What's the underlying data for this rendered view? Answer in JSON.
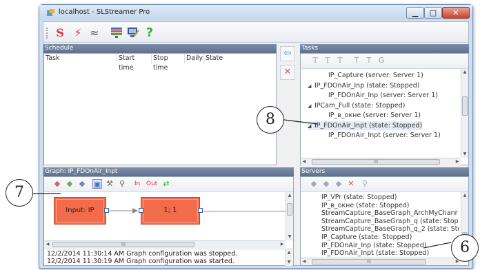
{
  "window": {
    "title": "localhost - SLStreamer Pro",
    "min_glyph": "▁",
    "max_glyph": "□",
    "close_glyph": "✕"
  },
  "toolbar": {
    "icons": [
      "s-logo-icon",
      "lightning-icon",
      "waves-icon",
      "monitor-tasks-icon",
      "monitor-edit-icon",
      "help-icon"
    ]
  },
  "schedule": {
    "header": "Schedule",
    "columns": [
      "Task",
      "Start time",
      "Stop time",
      "Daily",
      "State"
    ]
  },
  "tasks": {
    "header": "Tasks",
    "items": [
      {
        "indent": 2,
        "arrow": "",
        "text": "IP_Capture (server: Server 1)"
      },
      {
        "indent": 1,
        "arrow": "◢",
        "text": "IP_FDOnAir_Inp (state: Stopped)"
      },
      {
        "indent": 2,
        "arrow": "",
        "text": "IP_FDOnAir_Inp (server: Server 1)"
      },
      {
        "indent": 1,
        "arrow": "◢",
        "text": "IPCam_Full (state: Stopped)"
      },
      {
        "indent": 2,
        "arrow": "",
        "text": "IP_в_окне (server: Server 1)"
      },
      {
        "indent": 1,
        "arrow": "◢",
        "text": "IP_FDOnAir_Inpt (state: Stopped)"
      },
      {
        "indent": 2,
        "arrow": "",
        "text": "IP_FDOnAir_Inpt (server: Server 1)"
      }
    ],
    "hscroll_grip": "III"
  },
  "graph": {
    "header": "Graph: IP_FDOnAir_Inpt",
    "node_input": "Input: IP",
    "node_second": "1; 1",
    "hscroll_grip": "III",
    "log": [
      "12/2/2014 11:30:14 AM Graph configuration was stopped.",
      "12/2/2014 11:30:19 AM Graph configuration was started."
    ]
  },
  "servers": {
    "header": "Servers",
    "items": [
      "IP_VPr (state: Stopped)",
      "IP_в_окне (state: Stopped)",
      "StreamCapture_BaseGraph_ArchMyChanr",
      "StreamCapture_BaseGraph_q (state: Stop",
      "StreamCapture_BaseGraph_q_2 (state: Sto",
      "IP_Capture (state: Stopped)",
      "IP_FDOnAir_Inp (state: Stopped)",
      "IP_FDOnAir_Inpt (state: Stopped)"
    ],
    "hscroll_grip": "III"
  },
  "callouts": {
    "c7": "7",
    "c8": "8",
    "c6": "6"
  },
  "colors": {
    "node_fill": "#f26c4b",
    "panel_header": "#6a7c99",
    "move_arrow": "#3d7fd6",
    "delete_x": "#e05050"
  }
}
